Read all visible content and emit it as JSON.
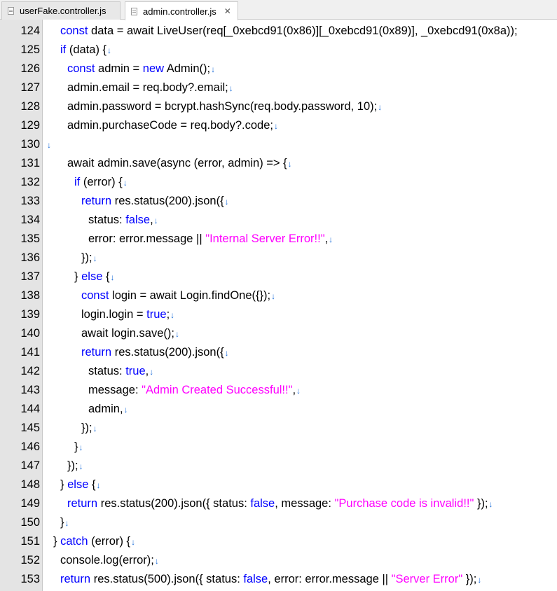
{
  "tabs": [
    {
      "label": "userFake.controller.js",
      "active": false,
      "closable": false
    },
    {
      "label": "admin.controller.js",
      "active": true,
      "closable": true,
      "close_glyph": "✕"
    }
  ],
  "colors": {
    "keyword": "#0000ff",
    "string": "#ff00ff",
    "text": "#000000",
    "eol_marker": "#1e6fd9",
    "gutter_bg": "#e4e4e4"
  },
  "eol_glyph": "↓",
  "lines": [
    {
      "number": "124",
      "indent": 2,
      "eol": false,
      "tokens": [
        [
          "kw",
          "const"
        ],
        [
          "plain",
          " data = await LiveUser(req[_0xebcd91(0x86)][_0xebcd91(0x89)], _0xebcd91(0x8a));"
        ]
      ]
    },
    {
      "number": "125",
      "indent": 2,
      "eol": true,
      "tokens": [
        [
          "kw",
          "if"
        ],
        [
          "plain",
          " (data) {"
        ]
      ]
    },
    {
      "number": "126",
      "indent": 3,
      "eol": true,
      "tokens": [
        [
          "kw",
          "const"
        ],
        [
          "plain",
          " admin = "
        ],
        [
          "kw",
          "new"
        ],
        [
          "plain",
          " Admin();"
        ]
      ]
    },
    {
      "number": "127",
      "indent": 3,
      "eol": true,
      "tokens": [
        [
          "plain",
          "admin.email = req.body?.email;"
        ]
      ]
    },
    {
      "number": "128",
      "indent": 3,
      "eol": true,
      "tokens": [
        [
          "plain",
          "admin.password = bcrypt.hashSync(req.body.password, 10);"
        ]
      ]
    },
    {
      "number": "129",
      "indent": 3,
      "eol": true,
      "tokens": [
        [
          "plain",
          "admin.purchaseCode = req.body?.code;"
        ]
      ]
    },
    {
      "number": "130",
      "indent": 0,
      "eol": true,
      "tokens": []
    },
    {
      "number": "131",
      "indent": 3,
      "eol": true,
      "tokens": [
        [
          "plain",
          "await admin.save(async (error, admin) => {"
        ]
      ]
    },
    {
      "number": "132",
      "indent": 4,
      "eol": true,
      "tokens": [
        [
          "kw",
          "if"
        ],
        [
          "plain",
          " (error) {"
        ]
      ]
    },
    {
      "number": "133",
      "indent": 5,
      "eol": true,
      "tokens": [
        [
          "kw",
          "return"
        ],
        [
          "plain",
          " res.status(200).json({"
        ]
      ]
    },
    {
      "number": "134",
      "indent": 6,
      "eol": true,
      "tokens": [
        [
          "plain",
          "status: "
        ],
        [
          "kw",
          "false"
        ],
        [
          "plain",
          ","
        ]
      ]
    },
    {
      "number": "135",
      "indent": 6,
      "eol": true,
      "tokens": [
        [
          "plain",
          "error: error.message || "
        ],
        [
          "str",
          "\"Internal Server Error!!\""
        ],
        [
          "plain",
          ","
        ]
      ]
    },
    {
      "number": "136",
      "indent": 5,
      "eol": true,
      "tokens": [
        [
          "plain",
          "});"
        ]
      ]
    },
    {
      "number": "137",
      "indent": 4,
      "eol": true,
      "tokens": [
        [
          "plain",
          "} "
        ],
        [
          "kw",
          "else"
        ],
        [
          "plain",
          " {"
        ]
      ]
    },
    {
      "number": "138",
      "indent": 5,
      "eol": true,
      "tokens": [
        [
          "kw",
          "const"
        ],
        [
          "plain",
          " login = await Login.findOne({});"
        ]
      ]
    },
    {
      "number": "139",
      "indent": 5,
      "eol": true,
      "tokens": [
        [
          "plain",
          "login.login = "
        ],
        [
          "kw",
          "true"
        ],
        [
          "plain",
          ";"
        ]
      ]
    },
    {
      "number": "140",
      "indent": 5,
      "eol": true,
      "tokens": [
        [
          "plain",
          "await login.save();"
        ]
      ]
    },
    {
      "number": "141",
      "indent": 5,
      "eol": true,
      "tokens": [
        [
          "kw",
          "return"
        ],
        [
          "plain",
          " res.status(200).json({"
        ]
      ]
    },
    {
      "number": "142",
      "indent": 6,
      "eol": true,
      "tokens": [
        [
          "plain",
          "status: "
        ],
        [
          "kw",
          "true"
        ],
        [
          "plain",
          ","
        ]
      ]
    },
    {
      "number": "143",
      "indent": 6,
      "eol": true,
      "tokens": [
        [
          "plain",
          "message: "
        ],
        [
          "str",
          "\"Admin Created Successful!!\""
        ],
        [
          "plain",
          ","
        ]
      ]
    },
    {
      "number": "144",
      "indent": 6,
      "eol": true,
      "tokens": [
        [
          "plain",
          "admin,"
        ]
      ]
    },
    {
      "number": "145",
      "indent": 5,
      "eol": true,
      "tokens": [
        [
          "plain",
          "});"
        ]
      ]
    },
    {
      "number": "146",
      "indent": 4,
      "eol": true,
      "tokens": [
        [
          "plain",
          "}"
        ]
      ]
    },
    {
      "number": "147",
      "indent": 3,
      "eol": true,
      "tokens": [
        [
          "plain",
          "});"
        ]
      ]
    },
    {
      "number": "148",
      "indent": 2,
      "eol": true,
      "tokens": [
        [
          "plain",
          "} "
        ],
        [
          "kw",
          "else"
        ],
        [
          "plain",
          " {"
        ]
      ]
    },
    {
      "number": "149",
      "indent": 3,
      "eol": true,
      "tokens": [
        [
          "kw",
          "return"
        ],
        [
          "plain",
          " res.status(200).json({ status: "
        ],
        [
          "kw",
          "false"
        ],
        [
          "plain",
          ", message: "
        ],
        [
          "str",
          "\"Purchase code is invalid!!\""
        ],
        [
          "plain",
          " });"
        ]
      ]
    },
    {
      "number": "150",
      "indent": 2,
      "eol": true,
      "tokens": [
        [
          "plain",
          "}"
        ]
      ]
    },
    {
      "number": "151",
      "indent": 1,
      "eol": true,
      "tokens": [
        [
          "plain",
          "} "
        ],
        [
          "kw",
          "catch"
        ],
        [
          "plain",
          " (error) {"
        ]
      ]
    },
    {
      "number": "152",
      "indent": 2,
      "eol": true,
      "tokens": [
        [
          "plain",
          "console.log(error);"
        ]
      ]
    },
    {
      "number": "153",
      "indent": 2,
      "eol": true,
      "tokens": [
        [
          "kw",
          "return"
        ],
        [
          "plain",
          " res.status(500).json({ status: "
        ],
        [
          "kw",
          "false"
        ],
        [
          "plain",
          ", error: error.message || "
        ],
        [
          "str",
          "\"Server Error\""
        ],
        [
          "plain",
          " });"
        ]
      ]
    }
  ]
}
